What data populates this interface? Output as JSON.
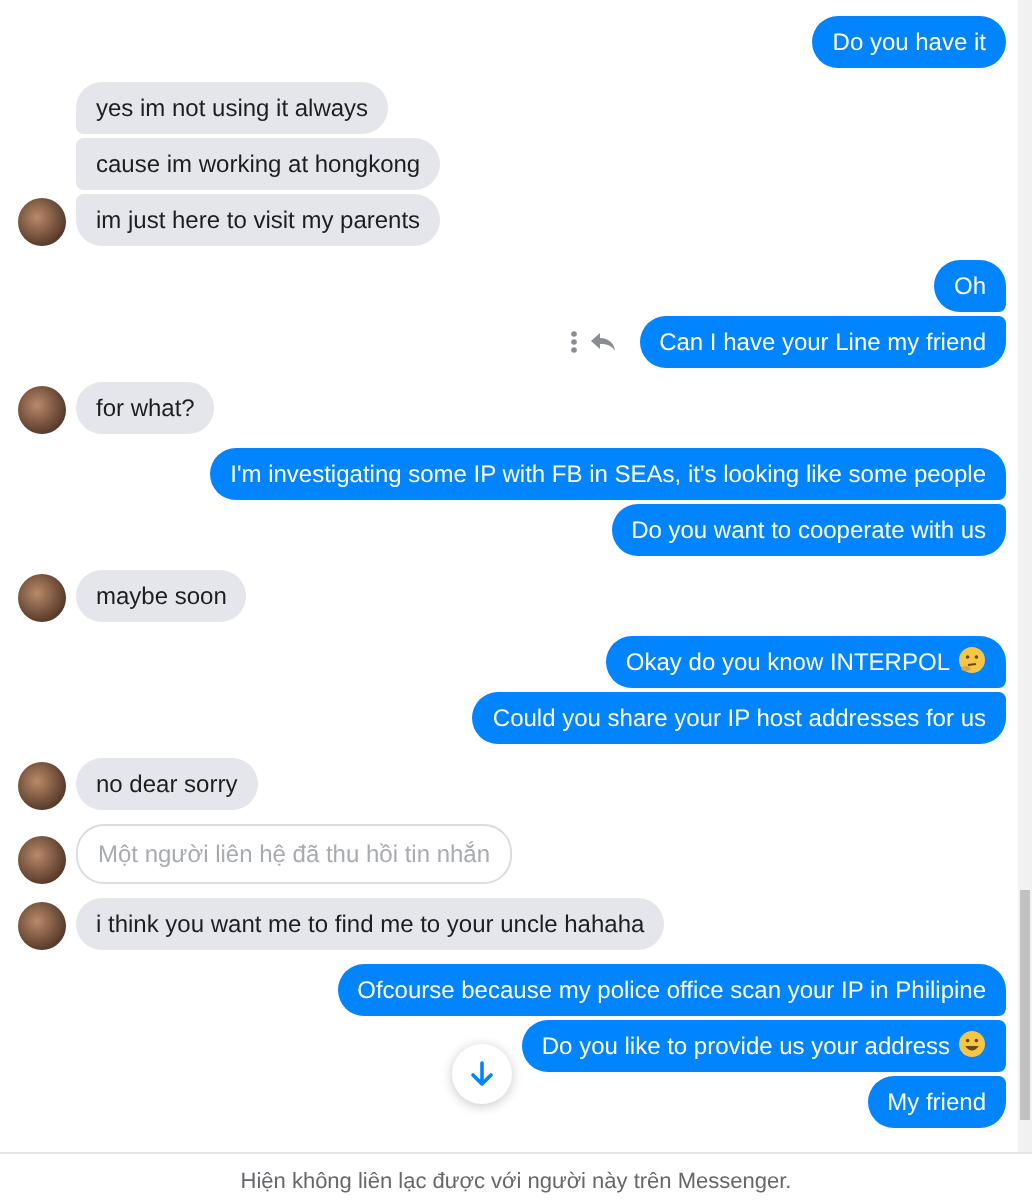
{
  "groups": [
    {
      "kind": "outgoing",
      "messages": [
        {
          "text": "Do you have it"
        }
      ]
    },
    {
      "kind": "incoming",
      "messages": [
        {
          "text": "yes im not using it always"
        },
        {
          "text": "cause im working at hongkong"
        },
        {
          "text": "im just here to visit my parents"
        }
      ]
    },
    {
      "kind": "outgoing",
      "messages": [
        {
          "text": "Oh"
        },
        {
          "text": "Can I have your Line my friend",
          "show_actions": true
        }
      ]
    },
    {
      "kind": "incoming",
      "messages": [
        {
          "text": "for what?"
        }
      ]
    },
    {
      "kind": "outgoing",
      "messages": [
        {
          "text": "I'm investigating some IP with FB in SEAs, it's looking like some people"
        },
        {
          "text": "Do you want to cooperate with us"
        }
      ]
    },
    {
      "kind": "incoming",
      "messages": [
        {
          "text": "maybe soon"
        }
      ]
    },
    {
      "kind": "outgoing",
      "messages": [
        {
          "text": "Okay do you know INTERPOL",
          "kind": "thinking"
        },
        {
          "text": "Could you share your IP host addresses for us"
        }
      ]
    },
    {
      "kind": "incoming",
      "messages": [
        {
          "text": "no dear sorry"
        }
      ]
    },
    {
      "kind": "incoming",
      "messages": [
        {
          "text": "Một người liên hệ đã thu hồi tin nhắn",
          "kind": "retracted"
        }
      ]
    },
    {
      "kind": "incoming",
      "messages": [
        {
          "text": "i think you want me to find me to your uncle hahaha"
        }
      ]
    },
    {
      "kind": "outgoing",
      "messages": [
        {
          "text": "Ofcourse because my police office scan your IP in Philipine"
        },
        {
          "text": "Do you like to provide us your address",
          "kind": "grinning"
        },
        {
          "text": "My friend"
        }
      ]
    }
  ],
  "footer": {
    "notice": "Hiện không liên lạc được với người này trên Messenger."
  }
}
